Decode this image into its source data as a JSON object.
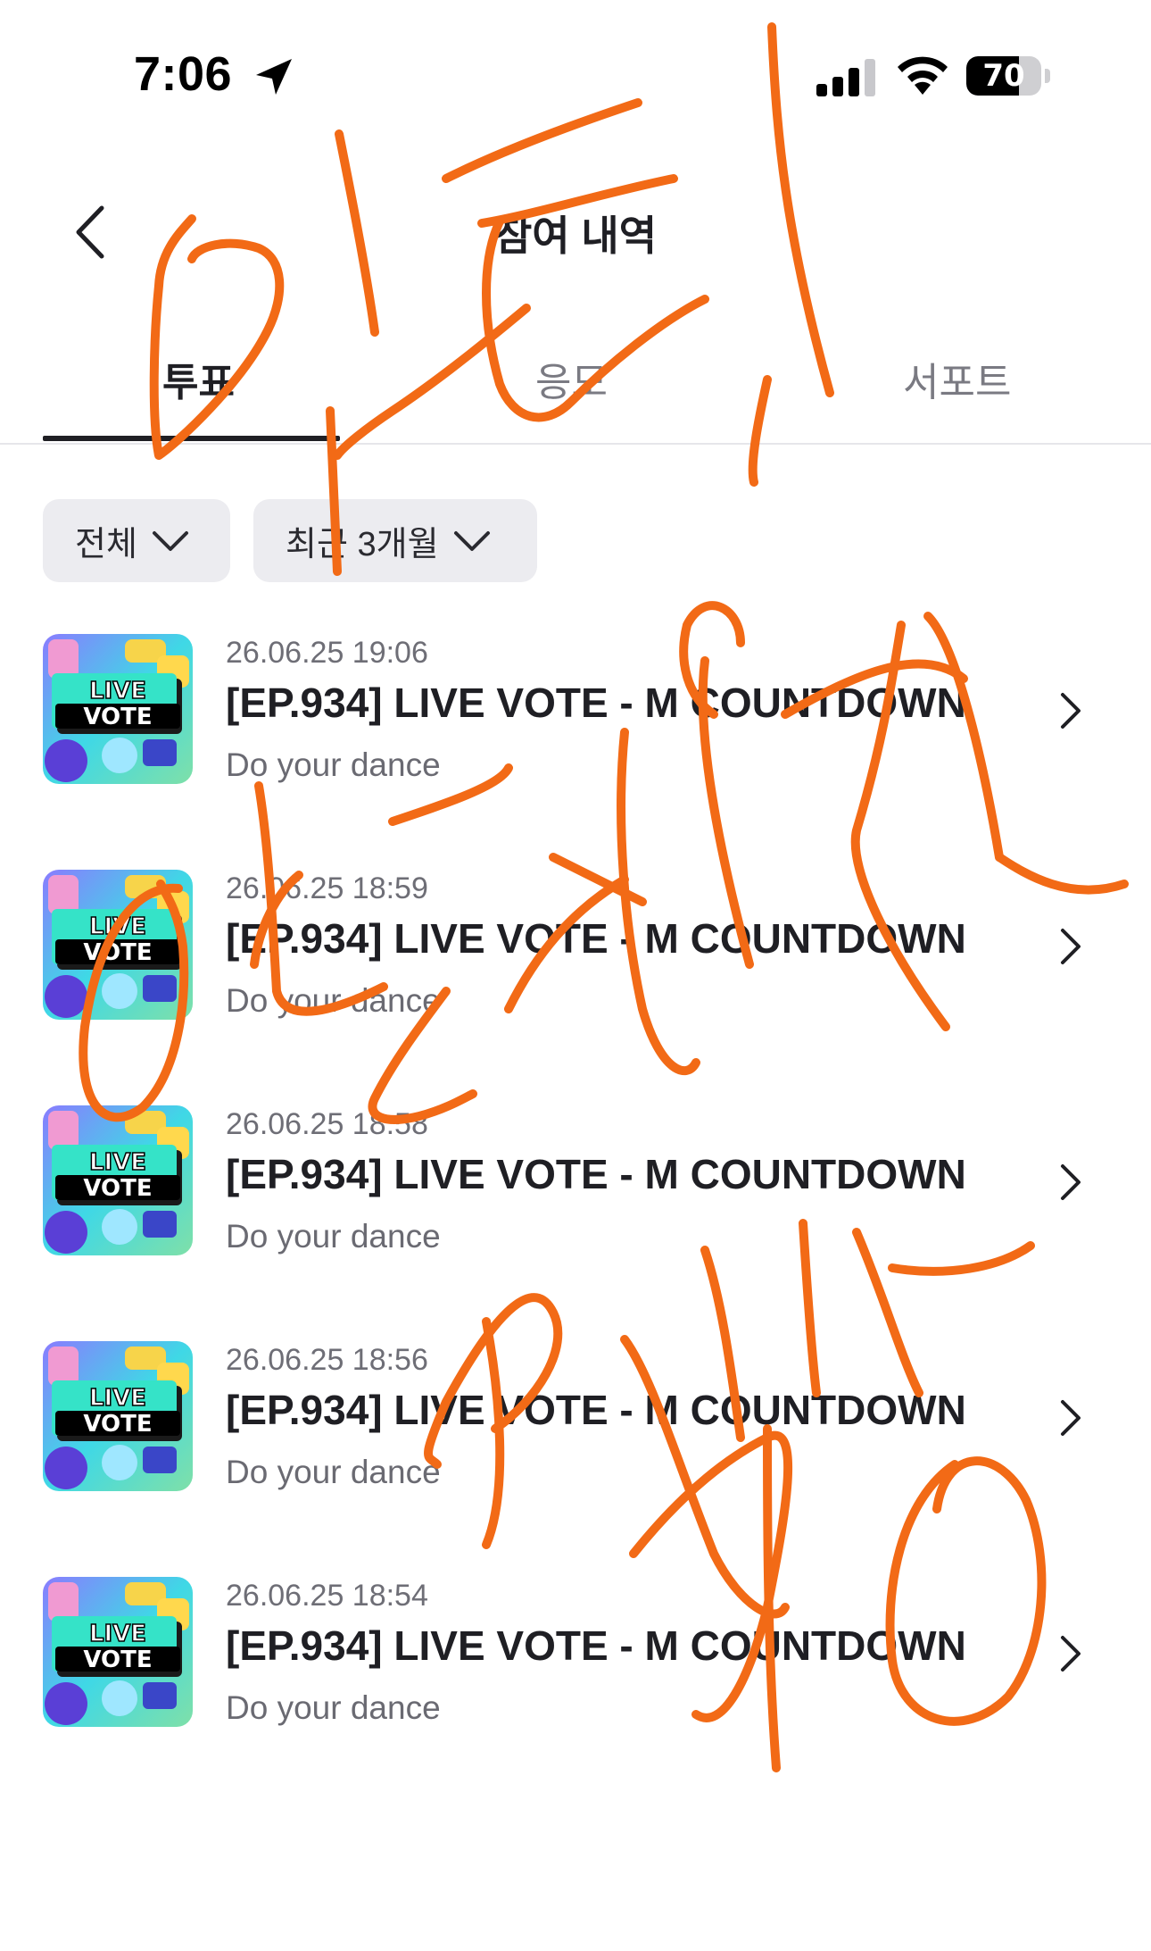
{
  "status_bar": {
    "time": "7:06",
    "battery": "70",
    "battery_level": 0.7
  },
  "header": {
    "title": "참여 내역"
  },
  "tabs": [
    {
      "label": "투표",
      "active": true
    },
    {
      "label": "응모",
      "active": false
    },
    {
      "label": "서포트",
      "active": false
    }
  ],
  "filters": [
    {
      "label": "전체"
    },
    {
      "label": "최근 3개월"
    }
  ],
  "items": [
    {
      "date": "26.06.25 19:06",
      "title": "[EP.934] LIVE VOTE - M COUNTDOWN",
      "subtitle": "Do your dance",
      "badge_line1": "LIVE",
      "badge_line2": "VOTE"
    },
    {
      "date": "26.06.25 18:59",
      "title": "[EP.934] LIVE VOTE - M COUNTDOWN",
      "subtitle": "Do your dance",
      "badge_line1": "LIVE",
      "badge_line2": "VOTE"
    },
    {
      "date": "26.06.25 18:58",
      "title": "[EP.934] LIVE VOTE - M COUNTDOWN",
      "subtitle": "Do your dance",
      "badge_line1": "LIVE",
      "badge_line2": "VOTE"
    },
    {
      "date": "26.06.25 18:56",
      "title": "[EP.934] LIVE VOTE - M COUNTDOWN",
      "subtitle": "Do your dance",
      "badge_line1": "LIVE",
      "badge_line2": "VOTE"
    },
    {
      "date": "26.06.25 18:54",
      "title": "[EP.934] LIVE VOTE - M COUNTDOWN",
      "subtitle": "Do your dance",
      "badge_line1": "LIVE",
      "badge_line2": "VOTE"
    }
  ],
  "colors": {
    "scribble": "#f26a16",
    "text_primary": "#1f1f24",
    "chip_bg": "#ececf0"
  },
  "icons": [
    "location-arrow-icon",
    "cellular-signal-icon",
    "wifi-icon",
    "battery-icon",
    "back-chevron-icon",
    "chevron-down-icon",
    "chevron-right-icon"
  ]
}
